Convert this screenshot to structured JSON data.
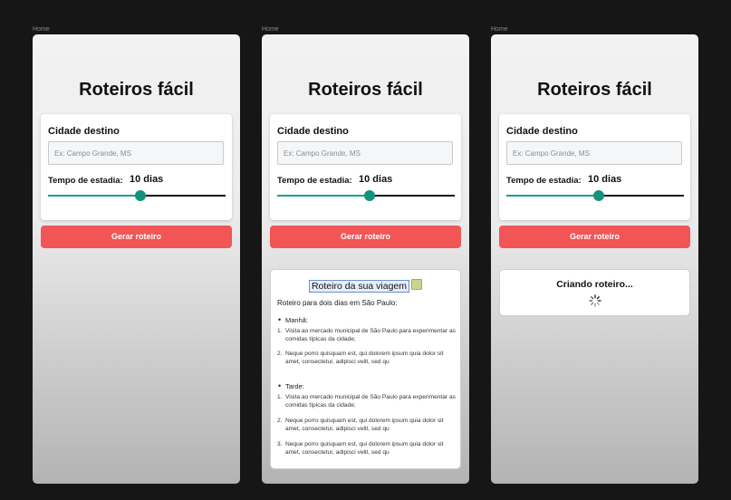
{
  "frame_label": "Home",
  "app": {
    "title": "Roteiros fácil",
    "city_label": "Cidade destino",
    "city_placeholder": "Ex: Campo Grande, MS",
    "stay_label": "Tempo de estadia:",
    "stay_value": "10 dias",
    "stay_slider_fraction": 0.52,
    "generate_button": "Gerar roteiro"
  },
  "result": {
    "title": "Roteiro da sua viagem",
    "intro": "Roteiro para dois dias em São Paulo:",
    "sections": [
      {
        "label": "Manhã:",
        "steps": [
          "Visita ao mercado municipal de São Paulo para experimentar as comidas típicas da cidade;",
          "Neque porro quisquam est, qui dolorem ipsum quia dolor sit amet, consectetur, adipisci velit, sed qu"
        ]
      },
      {
        "label": "Tarde:",
        "steps": [
          "Visita ao mercado municipal de São Paulo para experimentar as comidas típicas da cidade;",
          "Neque porro quisquam est, qui dolorem ipsum quia dolor sit amet, consectetur, adipisci velit, sed qu",
          "Neque porro quisquam est, qui dolorem ipsum quia dolor sit amet, consectetur, adipisci velit, sed qu"
        ]
      }
    ]
  },
  "loading": {
    "text": "Criando roteiro...",
    "icon": "spinner-icon"
  },
  "colors": {
    "background": "#161616",
    "accent_button": "#f25555",
    "slider_accent": "#14927e"
  }
}
